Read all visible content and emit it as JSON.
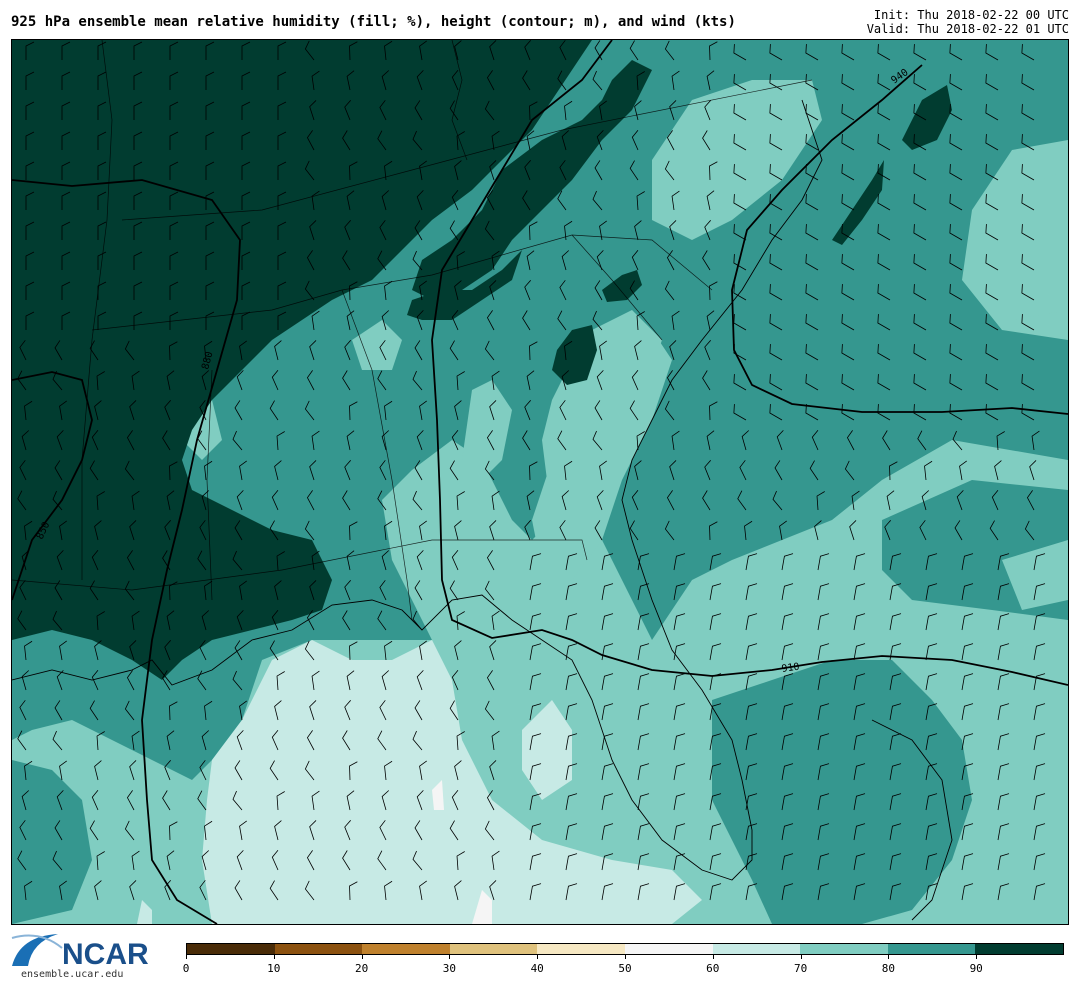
{
  "header": {
    "title": "925 hPa ensemble mean relative humidity (fill; %), height (contour; m), and wind (kts)",
    "init": "Init: Thu 2018-02-22 00 UTC",
    "valid": "Valid: Thu 2018-02-22 01 UTC"
  },
  "colors": {
    "rh_0": "#4a2c08",
    "rh_10": "#8c5210",
    "rh_20": "#bf812d",
    "rh_30": "#dfc27d",
    "rh_40": "#f6e8c3",
    "rh_50": "#f5f5f5",
    "rh_60": "#c7eae5",
    "rh_70": "#80cdc1",
    "rh_80": "#35978f",
    "rh_90": "#013c30"
  },
  "colorbar": {
    "ticks": [
      "0",
      "10",
      "20",
      "30",
      "40",
      "50",
      "60",
      "70",
      "80",
      "90"
    ]
  },
  "contours": {
    "label_850": "850",
    "label_880": "880",
    "label_910": "910",
    "label_940": "940"
  },
  "footer": {
    "logo_text": "NCAR",
    "url": "ensemble.ucar.edu"
  }
}
